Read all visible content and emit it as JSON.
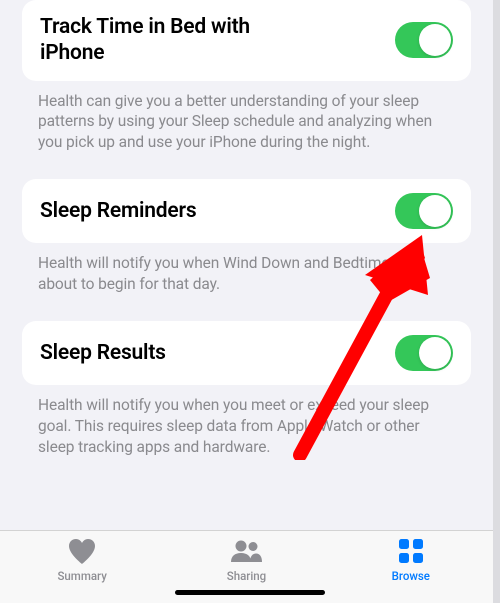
{
  "sections": [
    {
      "title": "Track Time in Bed with iPhone",
      "toggle_on": true,
      "footer": "Health can give you a better understanding of your sleep patterns by using your Sleep schedule and analyzing when you pick up and use your iPhone during the night."
    },
    {
      "title": "Sleep Reminders",
      "toggle_on": true,
      "footer": "Health will notify you when Wind Down and Bedtime are about to begin for that day."
    },
    {
      "title": "Sleep Results",
      "toggle_on": true,
      "footer": "Health will notify you when you meet or exceed your sleep goal. This requires sleep data from Apple Watch or other sleep tracking apps and hardware."
    }
  ],
  "tabs": [
    {
      "label": "Summary",
      "icon": "heart-icon",
      "active": false
    },
    {
      "label": "Sharing",
      "icon": "people-icon",
      "active": false
    },
    {
      "label": "Browse",
      "icon": "grid-icon",
      "active": true
    }
  ],
  "colors": {
    "toggle_green": "#34c759",
    "active_blue": "#007aff",
    "inactive_gray": "#8e8e93"
  }
}
